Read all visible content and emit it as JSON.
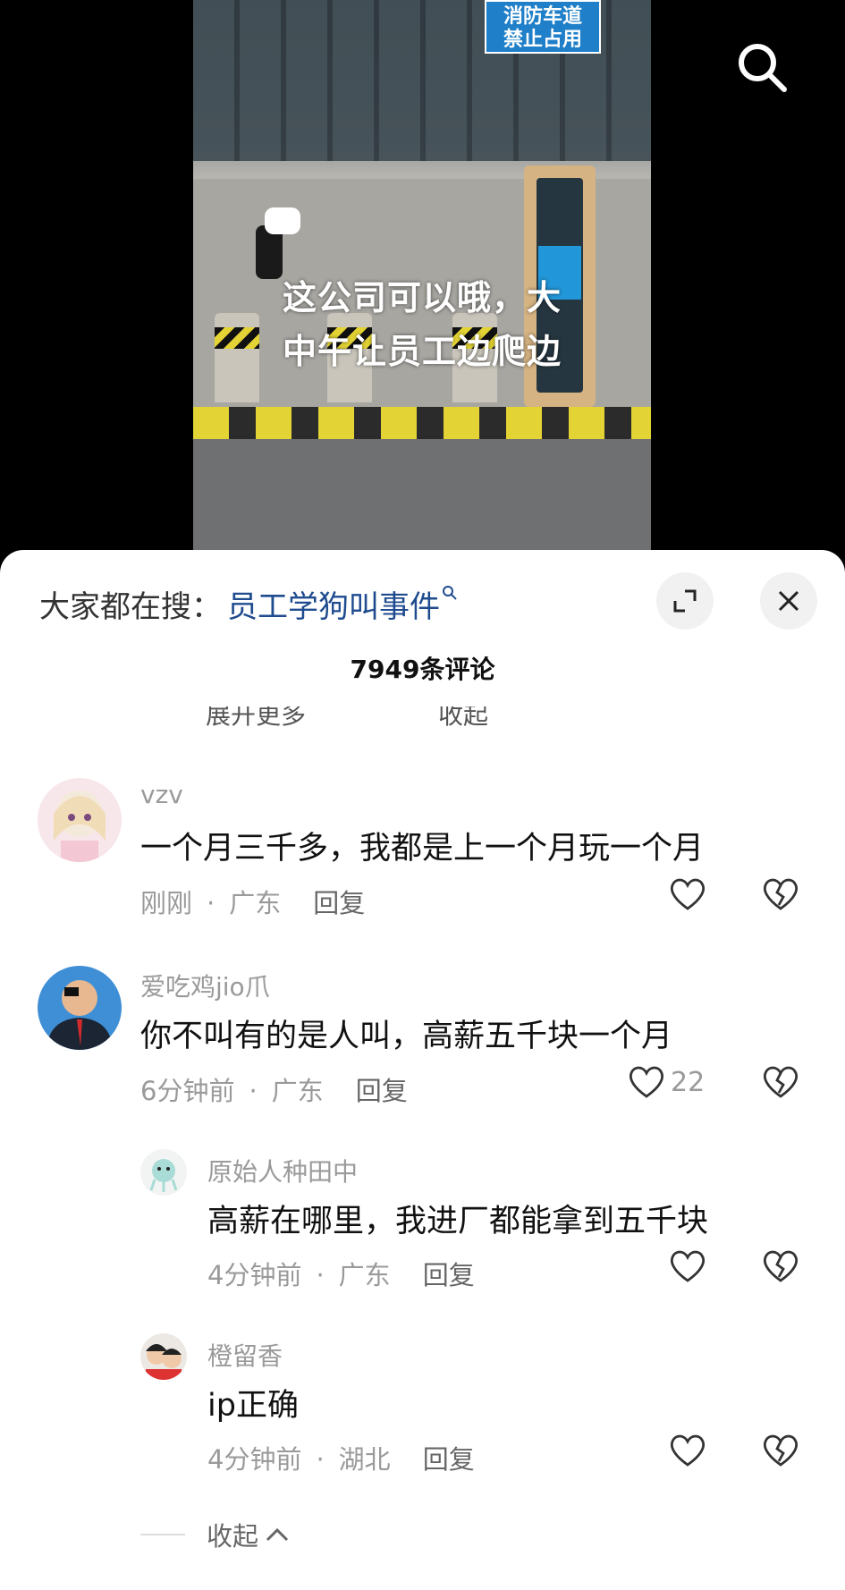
{
  "video": {
    "sign_line1": "消防车道",
    "sign_line2": "禁止占用",
    "caption_line1": "这公司可以哦，大",
    "caption_line2": "中午让员工边爬边"
  },
  "sheet": {
    "search_prefix": "大家都在搜：",
    "search_term": "员工学狗叫事件",
    "comment_count_title": "7949条评论",
    "ghost_left": "展开更多",
    "ghost_right": "收起"
  },
  "comments": [
    {
      "username": "vzv",
      "text": "一个月三千多，我都是上一个月玩一个月",
      "time": "刚刚",
      "location": "广东",
      "reply": "回复",
      "likes": ""
    },
    {
      "username": "爱吃鸡jio爪",
      "text": "你不叫有的是人叫，高薪五千块一个月",
      "time": "6分钟前",
      "location": "广东",
      "reply": "回复",
      "likes": "22"
    }
  ],
  "replies": [
    {
      "username": "原始人种田中",
      "text": "高薪在哪里，我进厂都能拿到五千块",
      "time": "4分钟前",
      "location": "广东",
      "reply": "回复"
    },
    {
      "username": "橙留香",
      "text": "ip正确",
      "time": "4分钟前",
      "location": "湖北",
      "reply": "回复"
    }
  ],
  "collapse_label": "收起",
  "icons": {
    "search": "search-icon",
    "expand": "expand-icon",
    "close": "close-icon",
    "like": "heart-icon",
    "dislike": "broken-heart-icon",
    "collapse": "chevron-up-icon"
  },
  "colors": {
    "search_term": "#1f4b8f",
    "meta_gray": "#9a9a9a"
  }
}
